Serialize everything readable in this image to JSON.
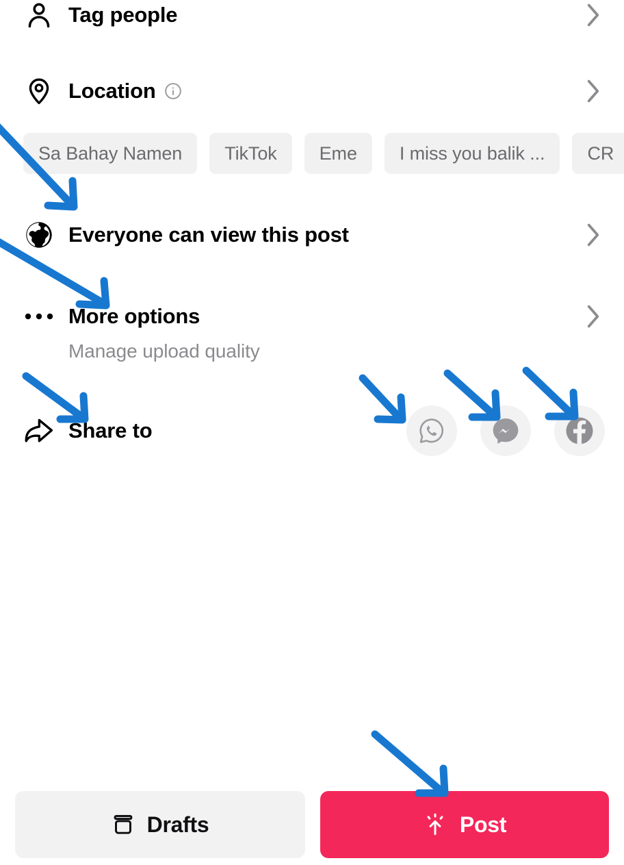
{
  "app": {
    "screen_name": "Post options",
    "background": "#ffffff",
    "accent_post": "#f4275a",
    "chip_background": "#f1f1f2",
    "annotation_arrow_color": "#1878d0"
  },
  "rows": [
    {
      "id": "tag-people",
      "icon": "person-icon",
      "label": "Tag people",
      "chevron": "›"
    },
    {
      "id": "location",
      "icon": "location-pin-icon",
      "label": "Location",
      "info_icon": "info-circle-icon",
      "chevron": "›"
    },
    {
      "id": "privacy",
      "icon": "globe-icon",
      "label": "Everyone can view this post",
      "chevron": "›"
    },
    {
      "id": "more-options",
      "icon": "ellipsis-icon",
      "label": "More options",
      "sublabel": "Manage upload quality",
      "chevron": "›"
    },
    {
      "id": "share-to",
      "icon": "share-arrow-icon",
      "label": "Share to"
    }
  ],
  "location_chips": [
    "Sa Bahay Namen",
    "TikTok",
    "Eme",
    "I miss you balik ...",
    "CR"
  ],
  "share_targets": [
    {
      "name": "whatsapp",
      "icon": "whatsapp-icon"
    },
    {
      "name": "messenger",
      "icon": "messenger-icon"
    },
    {
      "name": "facebook",
      "icon": "facebook-icon"
    }
  ],
  "bottom_bar": {
    "drafts_label": "Drafts",
    "drafts_icon": "drafts-box-icon",
    "post_label": "Post",
    "post_icon": "upload-arrow-icon"
  },
  "annotations": {
    "count": 6,
    "color": "#1878d0",
    "targets": [
      "location-chips",
      "privacy-row",
      "more-options-row",
      "share-to-row",
      "share-target-whatsapp",
      "share-target-messenger",
      "share-target-facebook",
      "post-button"
    ]
  }
}
